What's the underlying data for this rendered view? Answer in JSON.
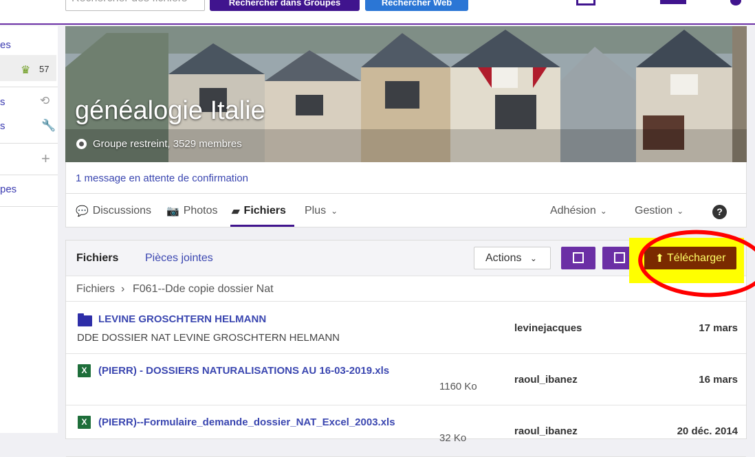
{
  "topbar": {
    "search_placeholder": "Rechercher des fichiers",
    "search_groups_label": "Rechercher dans Groupes",
    "search_web_label": "Rechercher Web"
  },
  "sidebar": {
    "items": [
      {
        "label": "es"
      },
      {
        "label": "57"
      },
      {
        "label": "s"
      },
      {
        "label": "s"
      },
      {
        "label": "pes"
      }
    ]
  },
  "banner": {
    "title": "généalogie Italie",
    "subtitle": "Groupe restreint, 3529 membres"
  },
  "pending": "1 message en attente de confirmation",
  "tabs": [
    {
      "label": "Discussions"
    },
    {
      "label": "Photos"
    },
    {
      "label": "Fichiers"
    },
    {
      "label": "Plus"
    }
  ],
  "right_tabs": [
    {
      "label": "Adhésion"
    },
    {
      "label": "Gestion"
    }
  ],
  "files": {
    "tab_files": "Fichiers",
    "tab_attachments": "Pièces jointes",
    "actions_label": "Actions",
    "upload_label": "Télécharger",
    "breadcrumb_root": "Fichiers",
    "breadcrumb_sep": "›",
    "breadcrumb_current": "F061--Dde copie dossier Nat",
    "rows": [
      {
        "type": "folder",
        "name": "LEVINE GROSCHTERN HELMANN",
        "desc": "DDE DOSSIER NAT LEVINE GROSCHTERN HELMANN",
        "size": "",
        "owner": "levinejacques",
        "date": "17 mars"
      },
      {
        "type": "xls",
        "name": "(PIERR) - DOSSIERS NATURALISATIONS AU 16-03-2019.xls",
        "desc": "",
        "size": "1160 Ko",
        "owner": "raoul_ibanez",
        "date": "16 mars"
      },
      {
        "type": "xls",
        "name": "(PIERR)--Formulaire_demande_dossier_NAT_Excel_2003.xls",
        "desc": "",
        "size": "32 Ko",
        "owner": "raoul_ibanez",
        "date": "20 déc. 2014"
      }
    ]
  },
  "colors": {
    "brand_purple": "#6b2fa5",
    "dark_purple": "#40148e",
    "link_blue": "#3a46b0",
    "annotation_red": "#ff0000",
    "highlight_yellow": "#ffff00"
  }
}
